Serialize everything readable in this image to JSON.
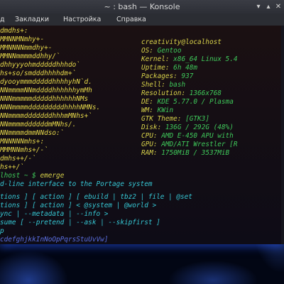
{
  "window": {
    "title": "~ : bash — Konsole",
    "menu": [
      "д",
      "Закладки",
      "Настройка",
      "Справка"
    ]
  },
  "logo_lines": [
    "dmdhs+:",
    "MMNNMNmhy+-",
    "MMNNNNmmdhy+-",
    "MMNNmmmmddhhy/`",
    "dhhyyyohmdddddhhhdo`",
    "hs+so/smdddhhhhdm+`",
    "dyooymmmdddddhhhhyhN`d.",
    "NNmmmmNNmddddhhhhhhymMh",
    "NNNmmmmmdddddhhhhhhNMs",
    "NNNmmmmdddddddddhhhhNMNs.",
    "NNmmmmdddddddhhhmMNhs+`",
    "NNmmmmddddddmMNhs/.",
    "NNmmmmdmmNNdso:`",
    "MNNNNNmhs+:",
    "MMMNNmhs+/-`",
    "dmhs++/-`",
    "hs++/`"
  ],
  "sysinfo": {
    "header": "creativity@localhost",
    "separator": "----------------",
    "fields": [
      {
        "key": "OS:",
        "value": "Gentoo"
      },
      {
        "key": "Kernel:",
        "value": "x86_64 Linux 5.4"
      },
      {
        "key": "Uptime:",
        "value": "6h 48m"
      },
      {
        "key": "Packages:",
        "value": "937"
      },
      {
        "key": "Shell:",
        "value": "bash"
      },
      {
        "key": "Resolution:",
        "value": "1366x768"
      },
      {
        "key": "DE:",
        "value": "KDE 5.77.0 / Plasma"
      },
      {
        "key": "WM:",
        "value": "KWin"
      },
      {
        "key": "GTK Theme:",
        "value": "[GTK3]"
      },
      {
        "key": "Disk:",
        "value": "136G / 292G (48%)"
      },
      {
        "key": "CPU:",
        "value": "AMD E-450 APU with"
      },
      {
        "key": "GPU:",
        "value": "AMD/ATI Wrestler [R"
      },
      {
        "key": "RAM:",
        "value": "1750MiB / 3537MiB"
      }
    ]
  },
  "command": {
    "prompt": "lhost ~ $",
    "cmd": "emerge"
  },
  "output": [
    "d-line interface to the Portage system",
    "tions ] [ action ] [ ebuild | tbz2 | file | @set",
    "tions ] [ action ] < @system | @world >",
    "ync | --metadata | --info >",
    "sume [ --pretend | --ask | --skipfirst ]",
    "p",
    "cdefghjkkInNoOpPqrsStuUvVw]"
  ]
}
